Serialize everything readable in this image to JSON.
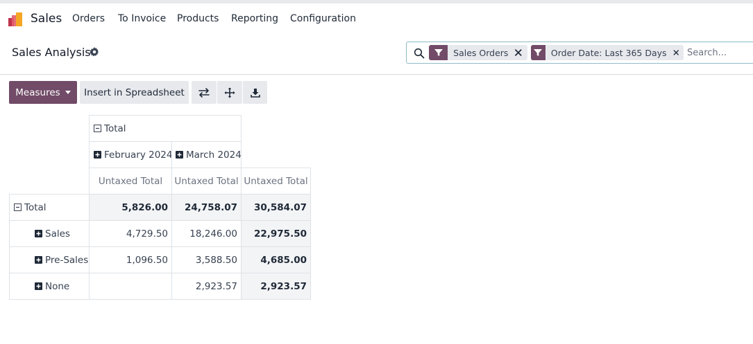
{
  "app": {
    "name": "Sales",
    "menu": [
      "Orders",
      "To Invoice",
      "Products",
      "Reporting",
      "Configuration"
    ]
  },
  "breadcrumb": "Sales Analysis",
  "search": {
    "facets": [
      "Sales Orders",
      "Order Date: Last 365 Days"
    ],
    "placeholder": "Search..."
  },
  "toolbar": {
    "measures_label": "Measures",
    "insert_label": "Insert in Spreadsheet",
    "icons": [
      "flip-axis-icon",
      "expand-all-icon",
      "download-icon"
    ]
  },
  "colors": {
    "primary": "#714b67",
    "secondary_bg": "#e7e9ed",
    "border": "#dee2e6"
  },
  "pivot": {
    "col_root": "Total",
    "col_groups": [
      "February 2024",
      "March 2024"
    ],
    "measure": "Untaxed Total",
    "row_root": "Total",
    "rows": [
      {
        "label": "Total",
        "values": [
          "5,826.00",
          "24,758.07",
          "30,584.07"
        ]
      },
      {
        "label": "Sales",
        "values": [
          "4,729.50",
          "18,246.00",
          "22,975.50"
        ]
      },
      {
        "label": "Pre-Sales",
        "values": [
          "1,096.50",
          "3,588.50",
          "4,685.00"
        ]
      },
      {
        "label": "None",
        "values": [
          "",
          "2,923.57",
          "2,923.57"
        ]
      }
    ]
  }
}
